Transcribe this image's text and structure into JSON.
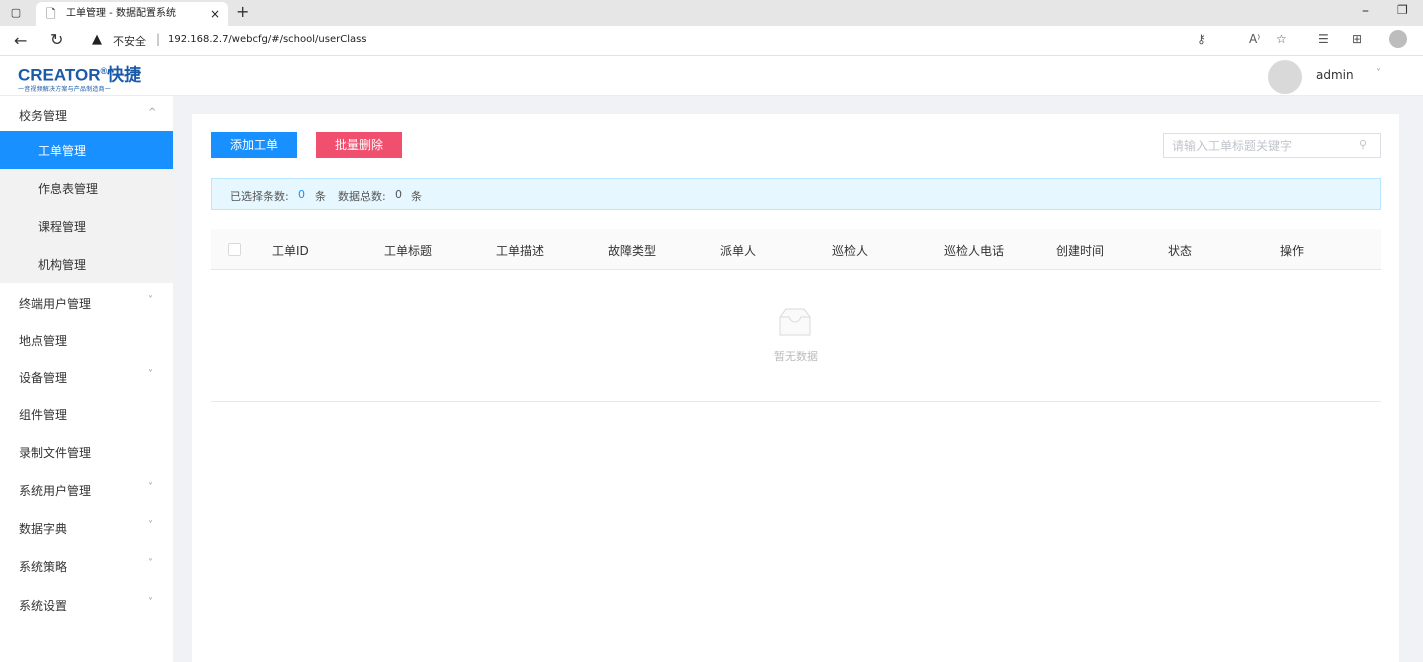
{
  "browser": {
    "tab_title": "工单管理 - 数据配置系统",
    "tab_close": "×",
    "new_tab": "+",
    "insecure_label": "不安全",
    "url": "192.168.2.7/webcfg/#/school/userClass"
  },
  "header": {
    "logo_text": "CREATOR",
    "logo_mark": "®",
    "logo_cn": "快捷",
    "logo_sub": "一音视频解决方案与产品制造商一",
    "username": "admin"
  },
  "sidebar": {
    "items": [
      {
        "label": "校务管理",
        "arrow": "^"
      },
      {
        "label": "终端用户管理",
        "arrow": "˅"
      },
      {
        "label": "地点管理"
      },
      {
        "label": "设备管理",
        "arrow": "˅"
      },
      {
        "label": "组件管理"
      },
      {
        "label": "录制文件管理"
      },
      {
        "label": "系统用户管理",
        "arrow": "˅"
      },
      {
        "label": "数据字典",
        "arrow": "˅"
      },
      {
        "label": "系统策略",
        "arrow": "˅"
      },
      {
        "label": "系统设置",
        "arrow": "˅"
      }
    ],
    "submenu": [
      {
        "label": "工单管理"
      },
      {
        "label": "作息表管理"
      },
      {
        "label": "课程管理"
      },
      {
        "label": "机构管理"
      }
    ]
  },
  "toolbar": {
    "add_label": "添加工单",
    "delete_label": "批量删除",
    "search_placeholder": "请输入工单标题关键字"
  },
  "info": {
    "selected_label": "已选择条数:",
    "selected_count": "0",
    "unit": "条",
    "total_label": "数据总数:",
    "total_count": "0"
  },
  "table": {
    "columns": [
      "工单ID",
      "工单标题",
      "工单描述",
      "故障类型",
      "派单人",
      "巡检人",
      "巡检人电话",
      "创建时间",
      "状态",
      "操作"
    ],
    "empty_text": "暂无数据"
  },
  "colors": {
    "primary": "#1890ff",
    "danger": "#f0506e"
  }
}
